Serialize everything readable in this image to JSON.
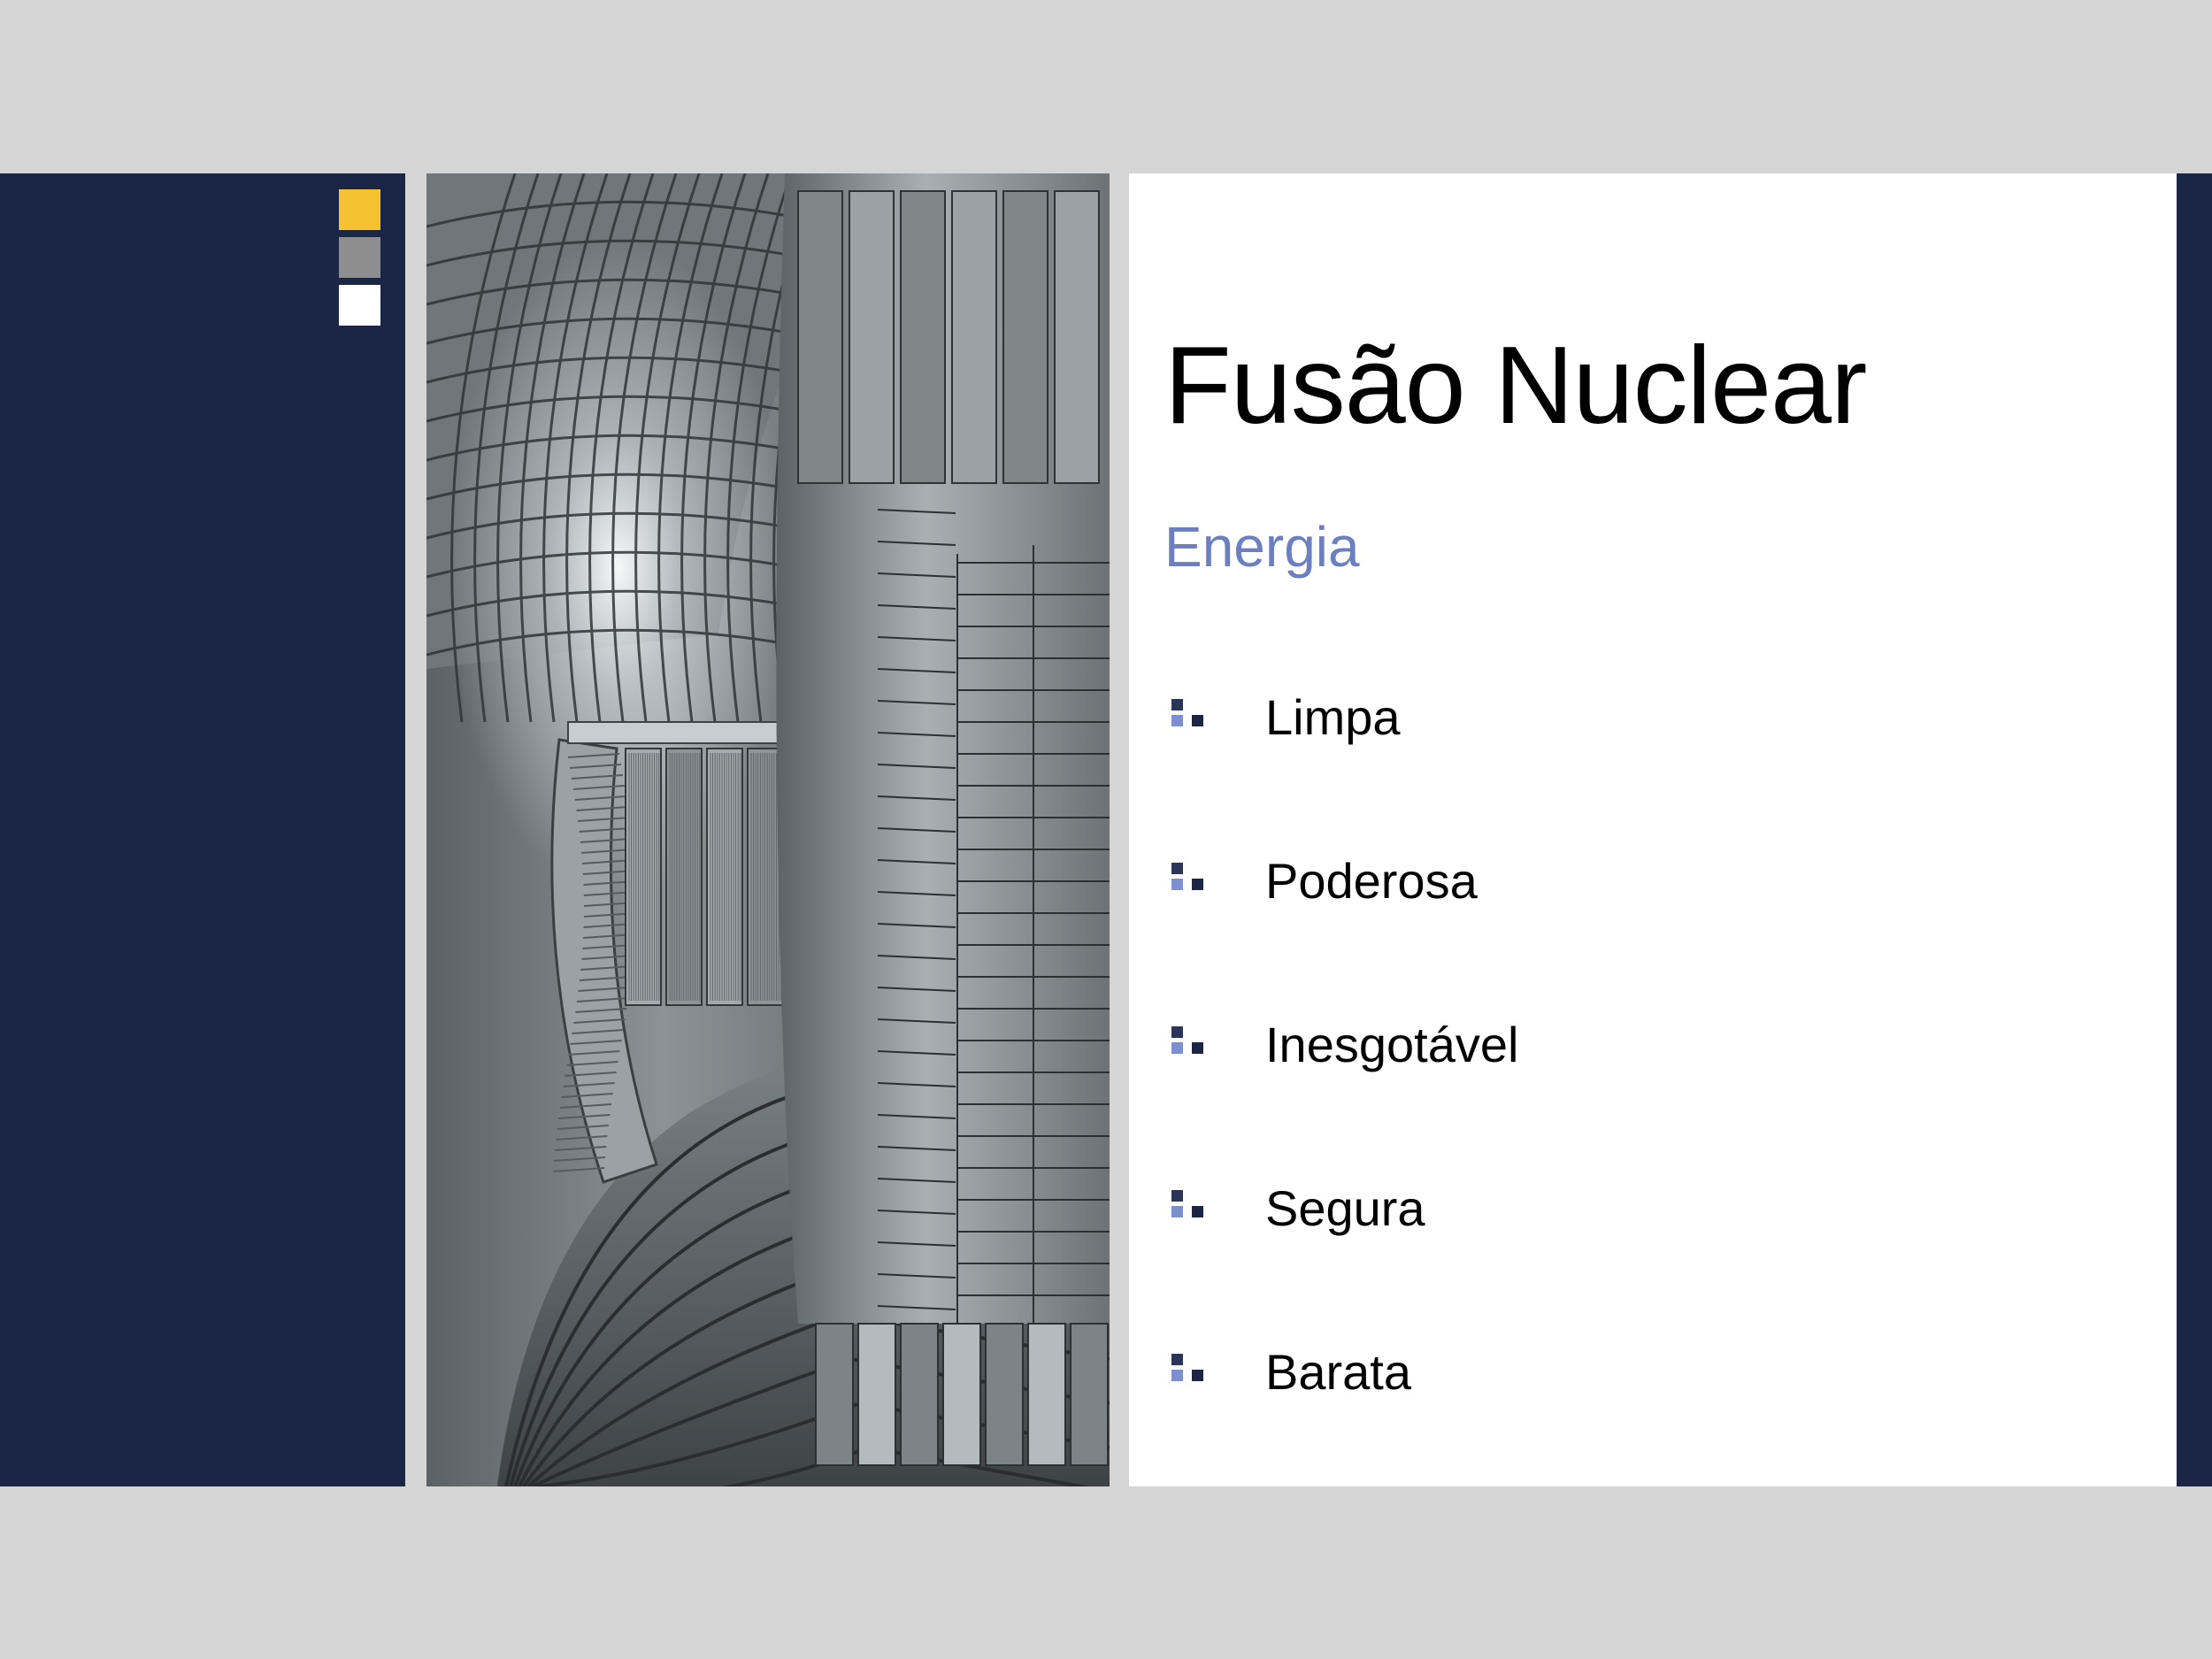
{
  "slide": {
    "title": "Fusão Nuclear",
    "subtitle": "Energia",
    "bullets": [
      {
        "label": "Limpa"
      },
      {
        "label": "Poderosa"
      },
      {
        "label": "Inesgotável"
      },
      {
        "label": "Segura"
      },
      {
        "label": "Barata"
      }
    ]
  },
  "colors": {
    "background": "#d5d5d5",
    "navy": "#1b2646",
    "accent_yellow": "#f6c231",
    "accent_gray": "#8e8e8e",
    "subtitle": "#6c7fbf",
    "bullet_icon": "#7d8fcf"
  },
  "icons": {
    "bullet": "square-cluster-bullet-icon",
    "photo": "tokamak-reactor-interior-photo"
  }
}
